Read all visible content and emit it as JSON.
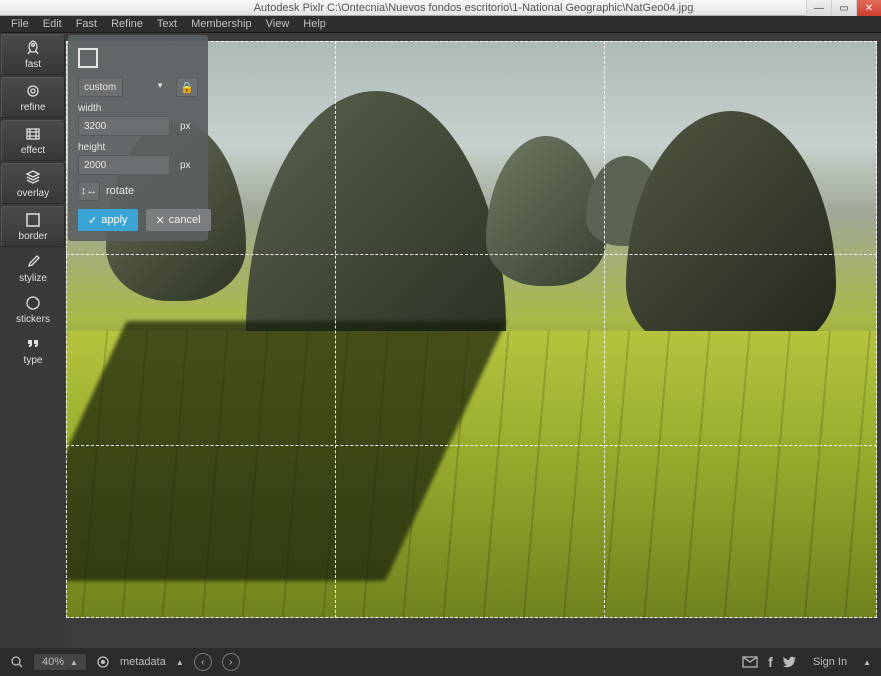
{
  "title": "Autodesk Pixlr   C:\\Ontecnia\\Nuevos fondos escritorio\\1-National Geographic\\NatGeo04.jpg",
  "menu": [
    "File",
    "Edit",
    "Fast",
    "Refine",
    "Text",
    "Membership",
    "View",
    "Help"
  ],
  "sidebar": [
    {
      "id": "fast",
      "label": "fast"
    },
    {
      "id": "refine",
      "label": "refine"
    },
    {
      "id": "effect",
      "label": "effect"
    },
    {
      "id": "overlay",
      "label": "overlay"
    },
    {
      "id": "border",
      "label": "border"
    },
    {
      "id": "stylize",
      "label": "stylize"
    },
    {
      "id": "stickers",
      "label": "stickers"
    },
    {
      "id": "type",
      "label": "type"
    }
  ],
  "panel": {
    "preset": "custom",
    "width_label": "width",
    "width_value": "3200",
    "width_unit": "px",
    "height_label": "height",
    "height_value": "2000",
    "height_unit": "px",
    "rotate_label": "rotate",
    "apply": "apply",
    "cancel": "cancel"
  },
  "status": {
    "zoom": "40%",
    "metadata": "metadata",
    "signin": "Sign In"
  }
}
